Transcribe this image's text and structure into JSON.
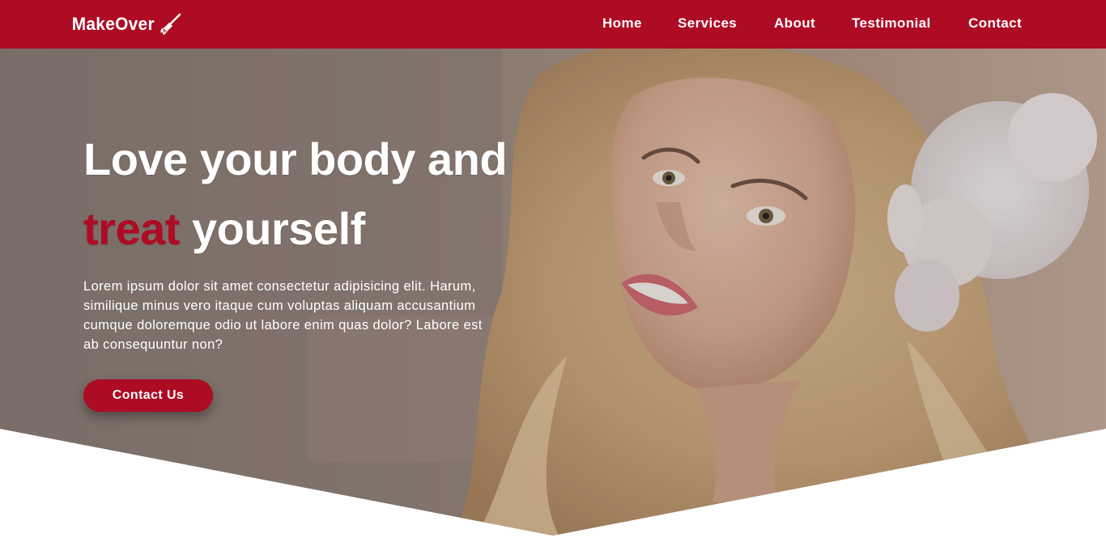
{
  "brand": {
    "name": "MakeOver",
    "icon": "brush-icon"
  },
  "nav": {
    "items": [
      {
        "label": "Home"
      },
      {
        "label": "Services"
      },
      {
        "label": "About"
      },
      {
        "label": "Testimonial"
      },
      {
        "label": "Contact"
      }
    ]
  },
  "hero": {
    "headline_line1": "Love your body and",
    "headline_accent": "treat",
    "headline_rest": " yourself",
    "description": "Lorem ipsum dolor sit amet consectetur adipisicing elit. Harum, similique minus vero itaque cum voluptas aliquam accusantium cumque doloremque odio ut labore enim quas dolor? Labore est ab consequuntur non?",
    "cta_label": "Contact Us"
  },
  "colors": {
    "brand_red": "#ae0b24",
    "text_white": "#ffffff",
    "page_background": "#ffffff"
  }
}
